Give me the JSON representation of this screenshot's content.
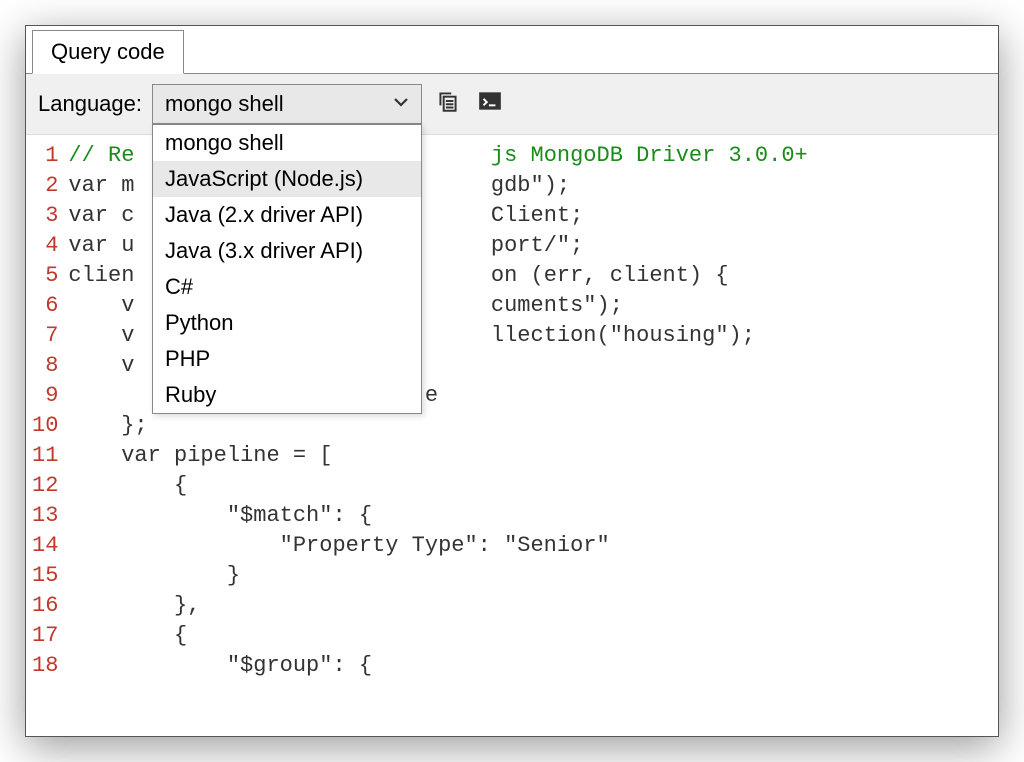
{
  "tab": {
    "label": "Query code"
  },
  "toolbar": {
    "language_label": "Language:",
    "selected": "mongo shell"
  },
  "dropdown": {
    "items": [
      "mongo shell",
      "JavaScript (Node.js)",
      "Java (2.x driver API)",
      "Java (3.x driver API)",
      "C#",
      "Python",
      "PHP",
      "Ruby"
    ],
    "highlighted_index": 1
  },
  "icons": {
    "copy": "copy-icon",
    "terminal": "terminal-icon"
  },
  "code": {
    "lines": [
      {
        "n": 1,
        "pre": "",
        "comment": "// Re",
        "tail_comment": "js MongoDB Driver 3.0.0+",
        "tail": ""
      },
      {
        "n": 2,
        "pre": "var m",
        "tail": "gdb\");"
      },
      {
        "n": 3,
        "pre": "var c",
        "tail": "Client;"
      },
      {
        "n": 4,
        "pre": "var u",
        "tail": "port/\";"
      },
      {
        "n": 5,
        "pre": "clien",
        "tail": "on (err, client) {"
      },
      {
        "n": 6,
        "pre": "    v",
        "tail": "cuments\");"
      },
      {
        "n": 7,
        "pre": "    v",
        "tail": "llection(\"housing\");"
      },
      {
        "n": 8,
        "pre": "    v",
        "tail": ""
      },
      {
        "n": 9,
        "pre": "",
        "tail": "e"
      },
      {
        "n": 10,
        "full": "    };"
      },
      {
        "n": 11,
        "full": "    var pipeline = ["
      },
      {
        "n": 12,
        "full": "        {"
      },
      {
        "n": 13,
        "full": "            \"$match\": {"
      },
      {
        "n": 14,
        "full": "                \"Property Type\": \"Senior\""
      },
      {
        "n": 15,
        "full": "            }"
      },
      {
        "n": 16,
        "full": "        },"
      },
      {
        "n": 17,
        "full": "        {"
      },
      {
        "n": 18,
        "full": "            \"$group\": {"
      }
    ]
  }
}
